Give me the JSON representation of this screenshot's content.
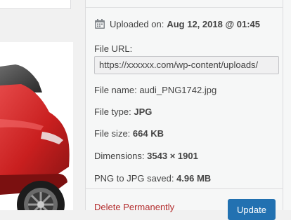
{
  "attachment": {
    "uploaded_label": "Uploaded on:",
    "uploaded_value": "Aug 12, 2018 @ 01:45",
    "file_url_label": "File URL:",
    "file_url_value": "https://xxxxxx.com/wp-content/uploads/",
    "file_name_label": "File name:",
    "file_name_value": "audi_PNG1742.jpg",
    "file_type_label": "File type:",
    "file_type_value": "JPG",
    "file_size_label": "File size:",
    "file_size_value": "664 KB",
    "dimensions_label": "Dimensions:",
    "dimensions_value": "3543 × 1901",
    "png_to_jpg_label": "PNG to JPG saved:",
    "png_to_jpg_value": "4.96 MB"
  },
  "actions": {
    "delete_label": "Delete Permanently",
    "update_label": "Update"
  },
  "icons": {
    "calendar": "calendar-icon"
  },
  "colors": {
    "delete_red": "#b32d2e",
    "update_blue": "#2271b1",
    "car_red": "#d32b2b"
  }
}
